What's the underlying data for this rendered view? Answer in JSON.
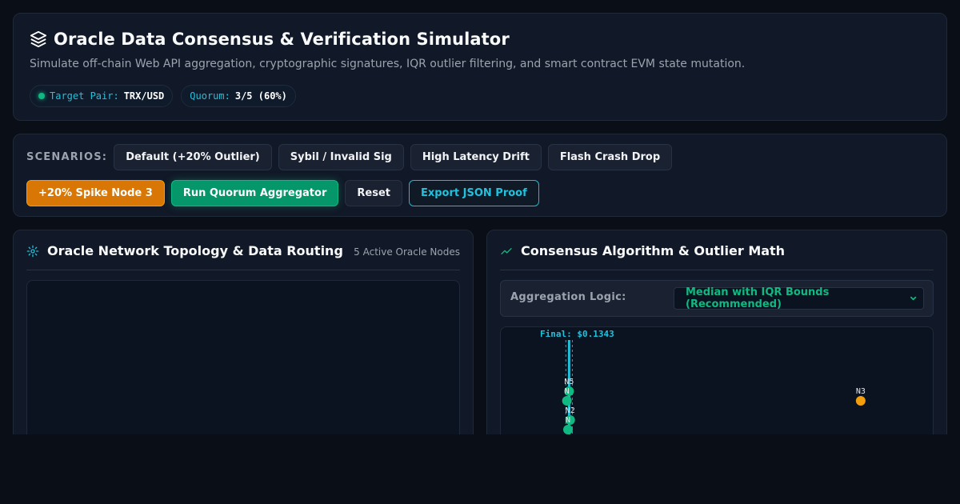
{
  "header": {
    "title": "Oracle Data Consensus & Verification Simulator",
    "subtitle": "Simulate off-chain Web API aggregation, cryptographic signatures, IQR outlier filtering, and smart contract EVM state mutation.",
    "pair_label": "Target Pair:",
    "pair_value": "TRX/USD",
    "quorum_label": "Quorum:",
    "quorum_value": "3/5 (60%)"
  },
  "scenarios": {
    "label": "SCENARIOS:",
    "items": [
      "Default (+20% Outlier)",
      "Sybil / Invalid Sig",
      "High Latency Drift",
      "Flash Crash Drop"
    ],
    "actions": {
      "spike": "+20% Spike Node 3",
      "run": "Run Quorum Aggregator",
      "reset": "Reset",
      "export": "Export JSON Proof"
    }
  },
  "topology": {
    "title": "Oracle Network Topology & Data Routing",
    "meta": "5 Active Oracle Nodes"
  },
  "consensus": {
    "title": "Consensus Algorithm & Outlier Math",
    "agg_label": "Aggregation Logic:",
    "agg_value": "Median with IQR Bounds (Recommended)"
  },
  "chart_data": {
    "type": "scatter",
    "final_label": "Final: $0.1343",
    "points": [
      {
        "label": "N5",
        "x": 0.1343,
        "row": 0,
        "status": "valid"
      },
      {
        "label": "N",
        "x": 0.1341,
        "row": 1,
        "status": "valid"
      },
      {
        "label": "N2",
        "x": 0.1344,
        "row": 2,
        "status": "valid"
      },
      {
        "label": "N",
        "x": 0.1342,
        "row": 3,
        "status": "valid"
      },
      {
        "label": "N3",
        "x": 0.1612,
        "row": 1,
        "status": "outlier"
      }
    ],
    "final": 0.1343,
    "iqr_bounds": [
      0.134,
      0.1346
    ],
    "xlim": [
      0.128,
      0.168
    ],
    "colors": {
      "valid": "#10b981",
      "outlier": "#f59e0b",
      "final": "#22c1dc"
    }
  }
}
